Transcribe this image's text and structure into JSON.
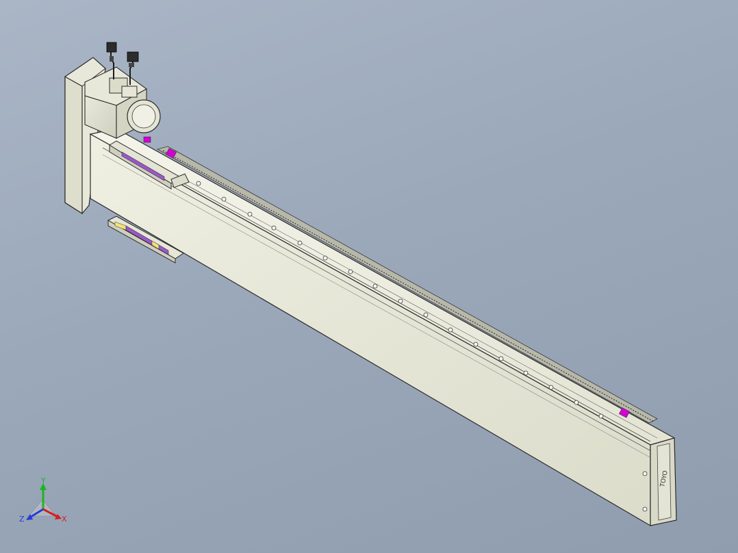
{
  "viewport": {
    "background_top": "#aab6c6",
    "background_bottom": "#8f9daf"
  },
  "model": {
    "body_color": "#e6e6d6",
    "edge_color": "#2b2b2b",
    "accent_magenta": "#d400d4",
    "accent_purple": "#9a58c8",
    "accent_yellow": "#f2e27a",
    "brand_text": "TOYO"
  },
  "triad": {
    "x_label": "X",
    "y_label": "Y",
    "z_label": "Z",
    "x_color": "#d61f1f",
    "y_color": "#1fb41f",
    "z_color": "#2a3bd6"
  }
}
